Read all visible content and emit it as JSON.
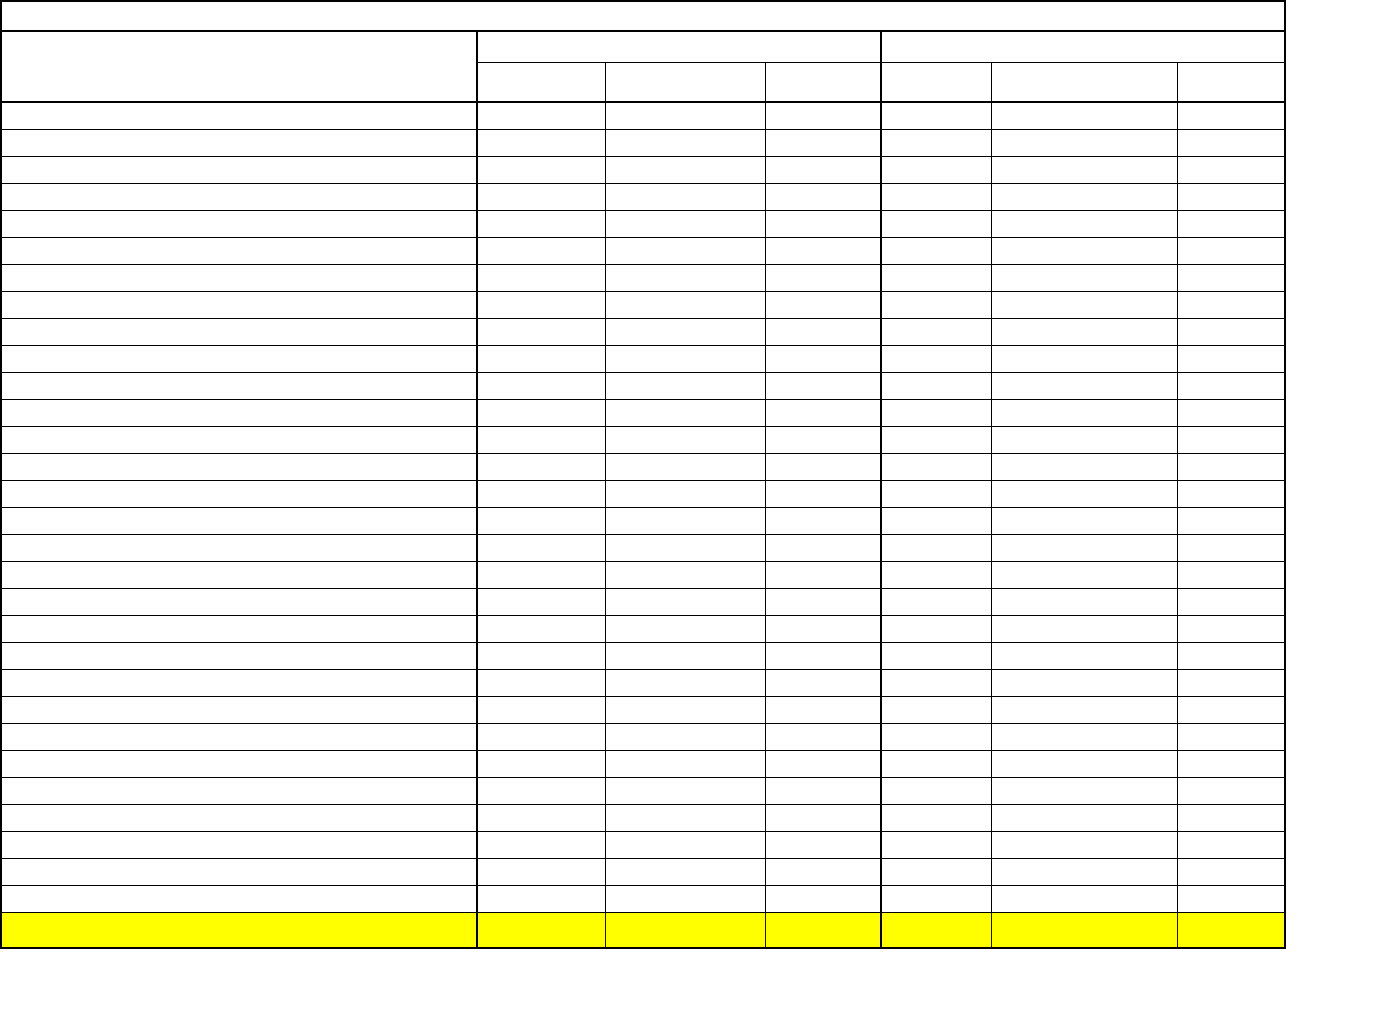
{
  "title": "",
  "header": {
    "col0": "",
    "group1": "",
    "group2": "",
    "sub": [
      "",
      "",
      "",
      "",
      "",
      ""
    ]
  },
  "rows": [
    [
      "",
      "",
      "",
      "",
      "",
      "",
      ""
    ],
    [
      "",
      "",
      "",
      "",
      "",
      "",
      ""
    ],
    [
      "",
      "",
      "",
      "",
      "",
      "",
      ""
    ],
    [
      "",
      "",
      "",
      "",
      "",
      "",
      ""
    ],
    [
      "",
      "",
      "",
      "",
      "",
      "",
      ""
    ],
    [
      "",
      "",
      "",
      "",
      "",
      "",
      ""
    ],
    [
      "",
      "",
      "",
      "",
      "",
      "",
      ""
    ],
    [
      "",
      "",
      "",
      "",
      "",
      "",
      ""
    ],
    [
      "",
      "",
      "",
      "",
      "",
      "",
      ""
    ],
    [
      "",
      "",
      "",
      "",
      "",
      "",
      ""
    ],
    [
      "",
      "",
      "",
      "",
      "",
      "",
      ""
    ],
    [
      "",
      "",
      "",
      "",
      "",
      "",
      ""
    ],
    [
      "",
      "",
      "",
      "",
      "",
      "",
      ""
    ],
    [
      "",
      "",
      "",
      "",
      "",
      "",
      ""
    ],
    [
      "",
      "",
      "",
      "",
      "",
      "",
      ""
    ],
    [
      "",
      "",
      "",
      "",
      "",
      "",
      ""
    ],
    [
      "",
      "",
      "",
      "",
      "",
      "",
      ""
    ],
    [
      "",
      "",
      "",
      "",
      "",
      "",
      ""
    ],
    [
      "",
      "",
      "",
      "",
      "",
      "",
      ""
    ],
    [
      "",
      "",
      "",
      "",
      "",
      "",
      ""
    ],
    [
      "",
      "",
      "",
      "",
      "",
      "",
      ""
    ],
    [
      "",
      "",
      "",
      "",
      "",
      "",
      ""
    ],
    [
      "",
      "",
      "",
      "",
      "",
      "",
      ""
    ],
    [
      "",
      "",
      "",
      "",
      "",
      "",
      ""
    ],
    [
      "",
      "",
      "",
      "",
      "",
      "",
      ""
    ],
    [
      "",
      "",
      "",
      "",
      "",
      "",
      ""
    ],
    [
      "",
      "",
      "",
      "",
      "",
      "",
      ""
    ],
    [
      "",
      "",
      "",
      "",
      "",
      "",
      ""
    ],
    [
      "",
      "",
      "",
      "",
      "",
      "",
      ""
    ],
    [
      "",
      "",
      "",
      "",
      "",
      "",
      ""
    ]
  ],
  "total_row": [
    "",
    "",
    "",
    "",
    "",
    "",
    ""
  ]
}
